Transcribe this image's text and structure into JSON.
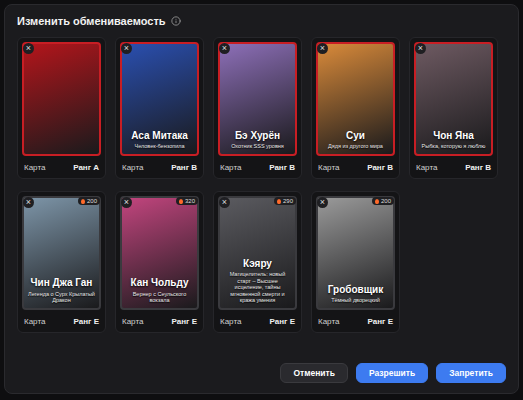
{
  "dialog": {
    "title": "Изменить обмениваемость"
  },
  "cards": [
    {
      "name": "",
      "subtitle": "",
      "type": "Карта",
      "rank": "Ранг A",
      "badge": "",
      "close": "×",
      "color": "#b3151b"
    },
    {
      "name": "Аса Митака",
      "subtitle": "Человек-бензопила",
      "type": "Карта",
      "rank": "Ранг B",
      "badge": "",
      "close": "×",
      "color": "#2a4fb0"
    },
    {
      "name": "Бэ Хурён",
      "subtitle": "Охотник SSS уровня",
      "type": "Карта",
      "rank": "Ранг B",
      "badge": "",
      "close": "×",
      "color": "#8d6fb8"
    },
    {
      "name": "Суи",
      "subtitle": "Дядя из другого мира",
      "type": "Карта",
      "rank": "Ранг B",
      "badge": "",
      "close": "×",
      "color": "#d98a3a"
    },
    {
      "name": "Чон Яна",
      "subtitle": "Рыбка, которую я люблю",
      "type": "Карта",
      "rank": "Ранг B",
      "badge": "",
      "close": "×",
      "color": "#6e5a62"
    },
    {
      "name": "Чин Джа Ган",
      "subtitle": "Легенда о Сурх Крылатый Дракон",
      "type": "Карта",
      "rank": "Ранг E",
      "badge": "200",
      "close": "×",
      "color": "#7d95a8"
    },
    {
      "name": "Кан Чольду",
      "subtitle": "Вернер с Сеульского вокзала",
      "type": "Карта",
      "rank": "Ранг E",
      "badge": "320",
      "close": "×",
      "color": "#c2457e"
    },
    {
      "name": "Кэяру",
      "subtitle": "Магицелитель: новый старт – Высшее исцеление, тайны мгновенной смерти и кража умения",
      "type": "Карта",
      "rank": "Ранг E",
      "badge": "290",
      "close": "×",
      "color": "#5b5b60"
    },
    {
      "name": "Гробовщик",
      "subtitle": "Тёмный дворецкий",
      "type": "Карта",
      "rank": "Ранг E",
      "badge": "200",
      "close": "×",
      "color": "#9a9a9a"
    }
  ],
  "buttons": [
    {
      "label": "Отменить",
      "primary": false
    },
    {
      "label": "Разрешить",
      "primary": true
    },
    {
      "label": "Запретить",
      "primary": true
    }
  ]
}
